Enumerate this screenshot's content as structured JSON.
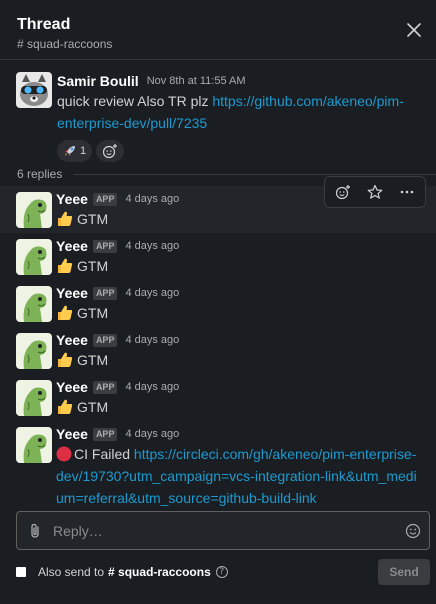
{
  "header": {
    "title": "Thread",
    "channel": "# squad-raccoons"
  },
  "parent": {
    "author": "Samir Boulil",
    "time": "Nov 8th at 11:55 AM",
    "text": "quick review Also TR plz ",
    "link": "https://github.com/akeneo/pim-enterprise-dev/pull/7235",
    "reaction_emoji": "rocket",
    "reaction_count": "1"
  },
  "replies_count": "6 replies",
  "replies": [
    {
      "author": "Yeee",
      "badge": "APP",
      "time": "4 days ago",
      "text": "GTM"
    },
    {
      "author": "Yeee",
      "badge": "APP",
      "time": "4 days ago",
      "text": "GTM"
    },
    {
      "author": "Yeee",
      "badge": "APP",
      "time": "4 days ago",
      "text": "GTM"
    },
    {
      "author": "Yeee",
      "badge": "APP",
      "time": "4 days ago",
      "text": "GTM"
    },
    {
      "author": "Yeee",
      "badge": "APP",
      "time": "4 days ago",
      "text": "GTM"
    },
    {
      "author": "Yeee",
      "badge": "APP",
      "time": "4 days ago",
      "text": "CI Failed ",
      "link": "https://circleci.com/gh/akeneo/pim-enterprise-dev/19730?utm_campaign=vcs-integration-link&utm_medium=referral&utm_source=github-build-link"
    }
  ],
  "composer": {
    "placeholder": "Reply…"
  },
  "footer": {
    "also_send_label": "Also send to",
    "channel": "# squad-raccoons",
    "help": "?",
    "send_label": "Send"
  },
  "colors": {
    "background": "#1a1d21",
    "link": "#1d9bd1",
    "hover_row": "#222529"
  }
}
